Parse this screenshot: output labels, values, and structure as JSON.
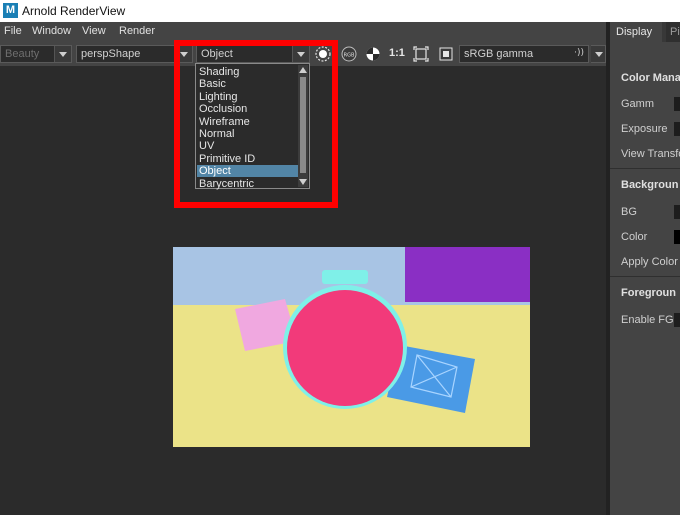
{
  "window": {
    "title": "Arnold RenderView",
    "logo_letter": "M"
  },
  "menubar": {
    "items": [
      "File",
      "Window",
      "View",
      "Render"
    ]
  },
  "toolbar": {
    "aov_value": "Beauty",
    "camera_value": "perspShape",
    "shading_value": "Object",
    "ratio_label": "1:1",
    "colorspace_value": "sRGB gamma"
  },
  "dropdown": {
    "items": [
      "Shading",
      "Basic",
      "Lighting",
      "Occlusion",
      "Wireframe",
      "Normal",
      "UV",
      "Primitive ID",
      "Object",
      "Barycentric"
    ],
    "selected": "Object"
  },
  "panel": {
    "tabs": [
      "Display",
      "Pix"
    ],
    "active_tab": "Display",
    "sections": {
      "color_management": {
        "title": "Color Mana",
        "fields": [
          "Gamm",
          "Exposure",
          "View Transfo"
        ]
      },
      "background": {
        "title": "Backgroun",
        "fields": [
          "BG",
          "Color",
          "Apply Color"
        ]
      },
      "foreground": {
        "title": "Foregroun",
        "fields": [
          "Enable FG"
        ]
      }
    }
  },
  "colors": {
    "highlight": "#ff0000",
    "selection": "#5285a6",
    "render_sky": "#a8c4e4",
    "render_floor": "#ebe388",
    "render_purple": "#8a2fc4",
    "watch_face": "#f23a7a",
    "watch_bezel": "#7ff0e8",
    "strap_left": "#f0a8e0",
    "strap_right": "#4a9ae6"
  }
}
